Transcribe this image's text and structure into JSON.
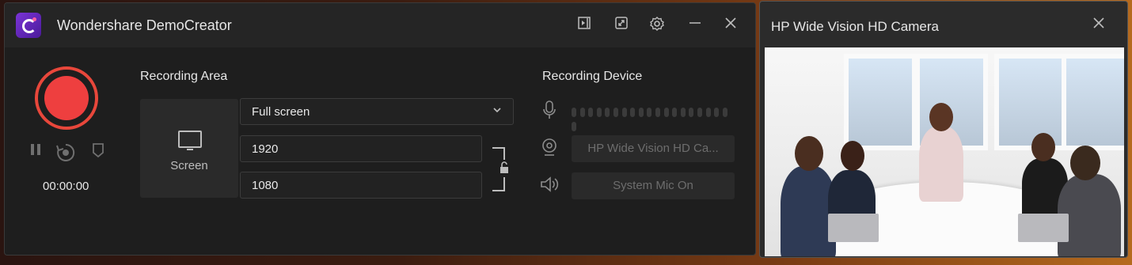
{
  "app": {
    "title": "Wondershare DemoCreator",
    "logo_icon": "democreator-logo-icon",
    "toolbar_icons": [
      "panel-toggle-icon",
      "resize-icon",
      "gear-icon",
      "minimize-icon",
      "close-icon"
    ]
  },
  "recorder": {
    "timer": "00:00:00",
    "record_color": "#ee3f3f",
    "controls": [
      "pause-icon",
      "restart-icon",
      "shield-icon"
    ]
  },
  "recording_area": {
    "title": "Recording Area",
    "screen_label": "Screen",
    "mode": "Full screen",
    "width": "1920",
    "height": "1080"
  },
  "recording_device": {
    "title": "Recording Device",
    "camera": "HP Wide Vision HD Ca...",
    "audio": "System Mic On"
  },
  "camera_window": {
    "title": "HP Wide Vision HD Camera"
  }
}
